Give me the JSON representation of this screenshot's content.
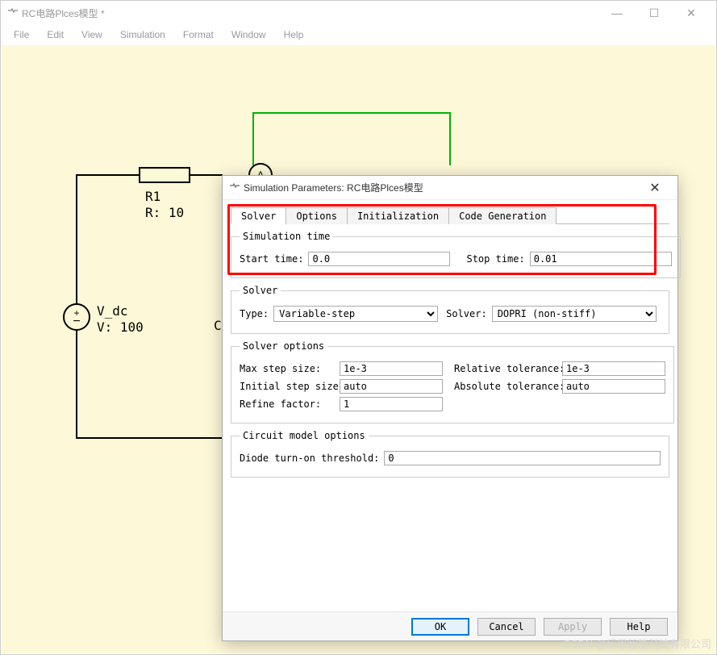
{
  "main": {
    "title": "RC电路Plces模型 *",
    "menus": [
      "File",
      "Edit",
      "View",
      "Simulation",
      "Format",
      "Window",
      "Help"
    ]
  },
  "circuit": {
    "r1_name": "R1",
    "r1_val": "R: 10",
    "vdc_name": "V_dc",
    "vdc_val": "V: 100",
    "ammeter": "A",
    "cap_partial": "C"
  },
  "dialog": {
    "title": "Simulation Parameters: RC电路Plces模型",
    "tabs": {
      "solver": "Solver",
      "options": "Options",
      "init": "Initialization",
      "codegen": "Code Generation"
    },
    "simtime": {
      "legend": "Simulation time",
      "start_label": "Start time:",
      "start_value": "0.0",
      "stop_label": "Stop time:",
      "stop_value": "0.01"
    },
    "solver_sec": {
      "legend": "Solver",
      "type_label": "Type:",
      "type_value": "Variable-step",
      "solver_label": "Solver:",
      "solver_value": "DOPRI (non-stiff)"
    },
    "solver_opts": {
      "legend": "Solver options",
      "maxstep_label": "Max step size:",
      "maxstep_value": "1e-3",
      "reltol_label": "Relative tolerance:",
      "reltol_value": "1e-3",
      "initstep_label": "Initial step size:",
      "initstep_value": "auto",
      "abstol_label": "Absolute tolerance:",
      "abstol_value": "auto",
      "refine_label": "Refine factor:",
      "refine_value": "1"
    },
    "circuit_opts": {
      "legend": "Circuit model options",
      "diode_label": "Diode turn-on threshold:",
      "diode_value": "0"
    },
    "buttons": {
      "ok": "OK",
      "cancel": "Cancel",
      "apply": "Apply",
      "help": "Help"
    }
  },
  "watermark": "CSDN @乐思智能科技有限公司"
}
